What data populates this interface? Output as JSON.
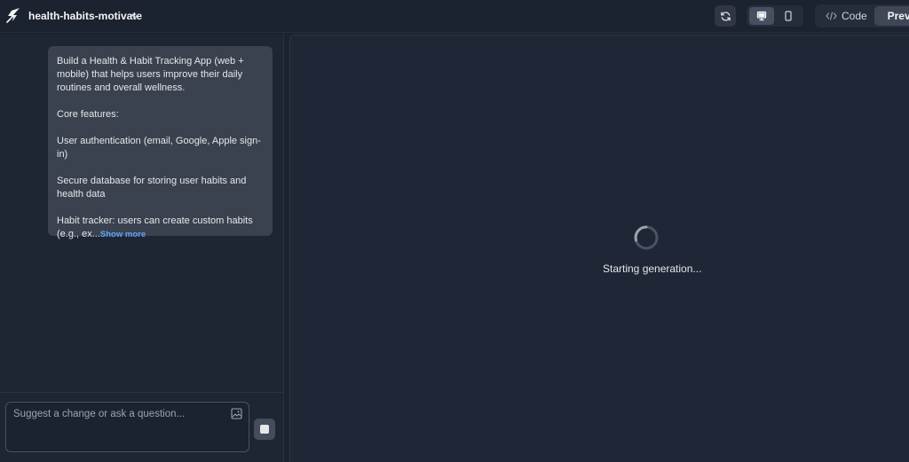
{
  "header": {
    "project_name": "health-habits-motivate",
    "code_label": "Code",
    "preview_label": "Preview"
  },
  "icons": {
    "logo": "lightning-logo-icon",
    "project_menu": "chevron-down-icon",
    "refresh": "refresh-icon",
    "desktop": "monitor-icon",
    "mobile": "smartphone-icon",
    "code": "code-brackets-icon",
    "preview": "eye-icon",
    "attach": "image-icon",
    "stop": "stop-icon"
  },
  "chat": {
    "message": {
      "paragraphs": [
        "Build a Health & Habit Tracking App (web + mobile) that helps users improve their daily routines and overall wellness.",
        "Core features:",
        "User authentication (email, Google, Apple sign-in)",
        "Secure database for storing user habits and health data"
      ],
      "truncated_text": "Habit tracker: users can create custom habits (e.g., ex...",
      "show_more_label": "Show more"
    },
    "input_placeholder": "Suggest a change or ask a question..."
  },
  "preview": {
    "status_text": "Starting generation..."
  },
  "colors": {
    "background": "#1b2230",
    "panel": "#1f2736",
    "bubble": "#3a4250",
    "link": "#60a5fa"
  }
}
